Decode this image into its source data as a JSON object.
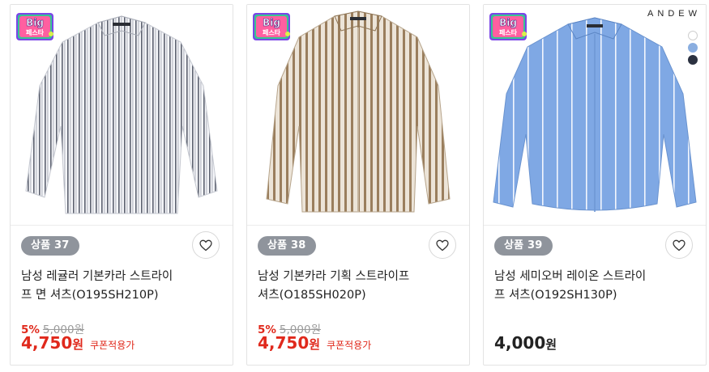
{
  "products": [
    {
      "tag": "상품 37",
      "title_line1": "남성 레귤러 기본카라 스트라이",
      "title_line2": "프 면 셔츠(O195SH210P)",
      "discount_rate": "5%",
      "original_price": "5,000원",
      "price": "4,750",
      "currency": "원",
      "coupon": "쿠폰적용가",
      "has_discount": true,
      "shirt_base": "#f4f5f8",
      "stripe_color": "#5d6270",
      "image_name": "gray-striped-shirt"
    },
    {
      "tag": "상품 38",
      "title_line1": "남성 기본카라 기획 스트라이프",
      "title_line2": "셔츠(O185SH020P)",
      "discount_rate": "5%",
      "original_price": "5,000원",
      "price": "4,750",
      "currency": "원",
      "coupon": "쿠폰적용가",
      "has_discount": true,
      "shirt_base": "#ece4d8",
      "stripe_color": "#9a7e5d",
      "image_name": "beige-striped-shirt"
    },
    {
      "tag": "상품 39",
      "title_line1": "남성 세미오버 레이온 스트라이",
      "title_line2": "프 셔츠(O192SH130P)",
      "price": "4,000",
      "currency": "원",
      "has_discount": false,
      "shirt_base": "#7fa8e4",
      "stripe_color": "#f2f6fd",
      "image_name": "blue-striped-shirt",
      "brand": "ANDEW",
      "color_options": [
        "#ffffff",
        "#8aaee0",
        "#2b3140"
      ]
    }
  ],
  "badge": {
    "big_text": "Big",
    "sub_text": "페스타"
  },
  "colors": {
    "discount_red": "#e0291c",
    "tag_gray": "#8f949c"
  }
}
